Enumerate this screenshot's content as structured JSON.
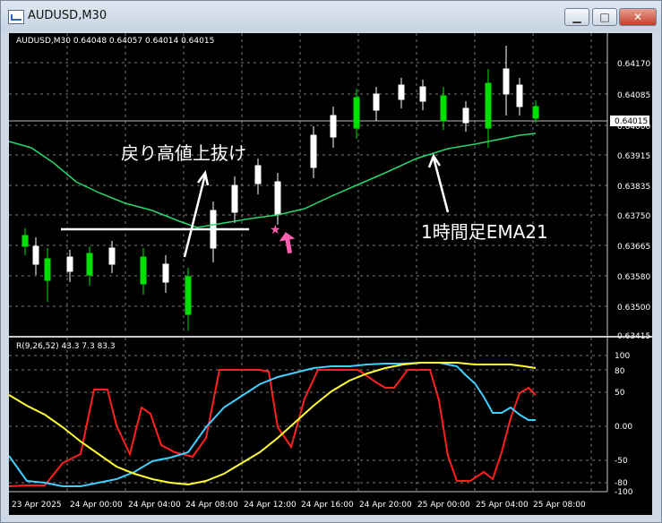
{
  "window": {
    "title": "AUDUSD,M30",
    "minimize_label": "▁",
    "restore_label": "□",
    "close_label": "✕"
  },
  "chart": {
    "header": "AUDUSD,M30  0.64048 0.64057 0.64014 0.64015",
    "current_price_label": "0.64015",
    "price_axis": [
      "0.64170",
      "0.64085",
      "0.64000",
      "0.63915",
      "0.63835",
      "0.63750",
      "0.63665",
      "0.63580",
      "0.63500",
      "0.63415"
    ],
    "time_axis": [
      "23 Apr 2025",
      "24 Apr 00:00",
      "24 Apr 04:00",
      "24 Apr 08:00",
      "24 Apr 12:00",
      "24 Apr 16:00",
      "24 Apr 20:00",
      "25 Apr 00:00",
      "25 Apr 04:00",
      "25 Apr 08:00"
    ],
    "annotation_break": "戻り高値上抜け",
    "annotation_ema": "1時間足EMA21",
    "colors": {
      "bull_candle": "#ffffff",
      "bear_candle": "#00e000",
      "ema_line": "#29d66f",
      "marker_star": "#ff5fb0",
      "marker_arrow": "#ff5fb0"
    }
  },
  "indicator": {
    "header": "R(9,26,52) 43.3 7.3 83.3",
    "axis": [
      "100",
      "80",
      "50",
      "0.00",
      "-50",
      "-80",
      "-100"
    ],
    "colors": {
      "red": "#ff2020",
      "cyan": "#40d0ff",
      "yellow": "#ffff33"
    }
  }
}
